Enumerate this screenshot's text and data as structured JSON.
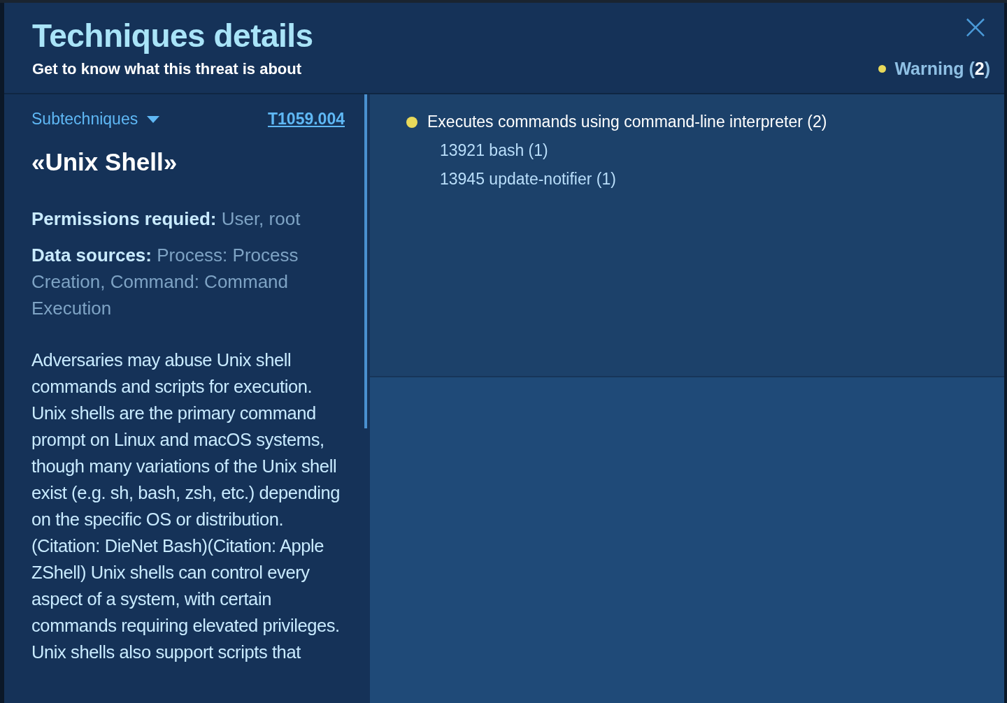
{
  "dialog": {
    "title": "Techniques details",
    "subtitle": "Get to know what this threat is about",
    "close_icon": "×",
    "severity": {
      "label": "Warning (**2**)",
      "color": "#e8d95a"
    }
  },
  "technique": {
    "subtechniques_label": "Subtechniques",
    "id": "T1059.004",
    "name": "«Unix Shell»",
    "fields": [
      {
        "label": "Permissions requied:",
        "value": "User, root"
      },
      {
        "label": "Data sources:",
        "value": "Process: Process Creation, Command: Command Execution"
      }
    ],
    "description": [
      "Adversaries may abuse Unix shell commands and scripts for execution. Unix shells are the primary command prompt on Linux and macOS systems, though many variations of the Unix shell exist (e.g. sh, bash, zsh, etc.) depending on the specific OS or distribution.(Citation: DieNet Bash)(Citation: Apple ZShell) Unix shells can control every aspect of a system, with certain commands requiring elevated privileges.",
      "Unix shells also support scripts that"
    ]
  },
  "behaviors": [
    {
      "title": "Executes commands using command-line interpreter (2)",
      "color": "#e8d95a",
      "processes": [
        "13921 bash (1)",
        "13945 update-notifier (1)"
      ]
    }
  ]
}
